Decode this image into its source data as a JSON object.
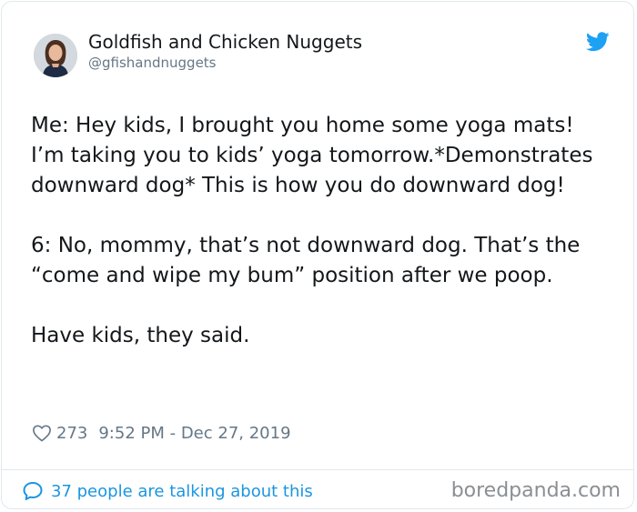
{
  "author": {
    "display_name": "Goldfish and Chicken Nuggets",
    "handle": "@gfishandnuggets",
    "avatar_icon": "avatar-photo",
    "platform_icon": "twitter-bird-icon"
  },
  "tweet": {
    "paragraphs": [
      "Me: Hey kids, I brought you home some yoga mats! I’m taking you to kids’ yoga tomorrow.*Demonstrates downward dog* This is how you do downward dog!",
      "6:  No, mommy, that’s not downward dog.  That’s the “come and wipe my bum” position after we poop.",
      "Have kids, they said."
    ]
  },
  "meta": {
    "like_icon": "heart-icon",
    "like_count": "273",
    "timestamp": "9:52 PM - Dec 27, 2019"
  },
  "footer": {
    "talk_icon": "speech-bubble-icon",
    "talk_text": "37 people are talking about this",
    "watermark": "boredpanda.com"
  },
  "colors": {
    "text": "#14171a",
    "secondary_text": "#657786",
    "link": "#1b95e0",
    "twitter_blue": "#1da1f2",
    "border": "#e1e8ed",
    "watermark": "#8a8f94"
  }
}
